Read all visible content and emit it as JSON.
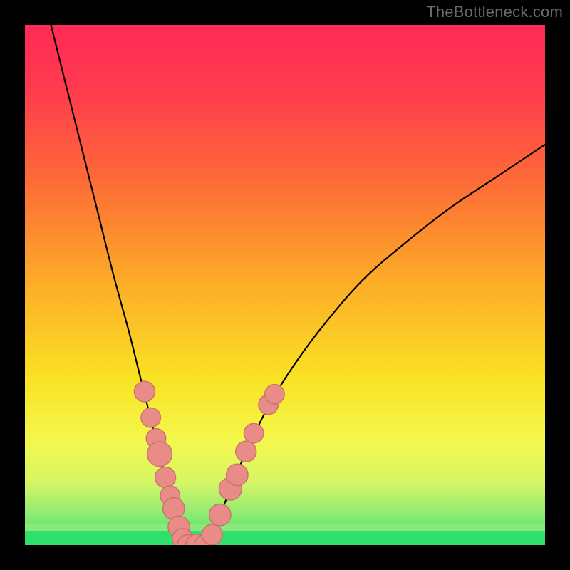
{
  "watermark": "TheBottleneck.com",
  "colors": {
    "gradient_stops": [
      {
        "offset": 0.0,
        "color": "#ff2a55"
      },
      {
        "offset": 0.12,
        "color": "#ff3a4e"
      },
      {
        "offset": 0.3,
        "color": "#fd6b37"
      },
      {
        "offset": 0.5,
        "color": "#fcae27"
      },
      {
        "offset": 0.68,
        "color": "#f9e224"
      },
      {
        "offset": 0.8,
        "color": "#f4f84d"
      },
      {
        "offset": 0.88,
        "color": "#d6f565"
      },
      {
        "offset": 0.94,
        "color": "#8feb72"
      },
      {
        "offset": 1.0,
        "color": "#2fe06a"
      }
    ],
    "curve": "#000000",
    "dot_fill": "#e98b86",
    "dot_stroke": "#c9716c",
    "frame": "#000000"
  },
  "chart_data": {
    "type": "line",
    "title": "",
    "xlabel": "",
    "ylabel": "",
    "xlim": [
      0,
      100
    ],
    "ylim": [
      0,
      100
    ],
    "grid": false,
    "legend": false,
    "series": [
      {
        "name": "left_curve",
        "x": [
          5,
          8,
          11,
          14,
          17,
          20,
          22,
          24,
          25.5,
          27,
          28,
          29,
          29.7,
          30.3,
          31
        ],
        "y": [
          100,
          88,
          76,
          64,
          52,
          41,
          33,
          25,
          19,
          13,
          9,
          5.5,
          3,
          1.2,
          0
        ]
      },
      {
        "name": "floor",
        "x": [
          31,
          32,
          33,
          34,
          35
        ],
        "y": [
          0,
          0,
          0,
          0,
          0
        ]
      },
      {
        "name": "right_curve",
        "x": [
          35,
          36.5,
          38,
          40,
          43,
          47,
          52,
          58,
          65,
          73,
          82,
          91,
          100
        ],
        "y": [
          0,
          3,
          7,
          12,
          19,
          27,
          35,
          43,
          51,
          58,
          65,
          71,
          77
        ]
      }
    ],
    "markers": [
      {
        "x": 23.0,
        "y": 29.5,
        "r": 1.3
      },
      {
        "x": 24.2,
        "y": 24.5,
        "r": 1.2
      },
      {
        "x": 25.2,
        "y": 20.5,
        "r": 1.2
      },
      {
        "x": 25.9,
        "y": 17.5,
        "r": 1.7
      },
      {
        "x": 27.0,
        "y": 13.0,
        "r": 1.3
      },
      {
        "x": 27.9,
        "y": 9.5,
        "r": 1.2
      },
      {
        "x": 28.6,
        "y": 7.0,
        "r": 1.4
      },
      {
        "x": 29.6,
        "y": 3.5,
        "r": 1.4
      },
      {
        "x": 30.3,
        "y": 1.2,
        "r": 1.3
      },
      {
        "x": 31.3,
        "y": 0.0,
        "r": 1.3
      },
      {
        "x": 33.0,
        "y": 0.0,
        "r": 1.4
      },
      {
        "x": 34.6,
        "y": 0.0,
        "r": 1.3
      },
      {
        "x": 36.0,
        "y": 2.0,
        "r": 1.3
      },
      {
        "x": 37.5,
        "y": 5.8,
        "r": 1.4
      },
      {
        "x": 39.5,
        "y": 10.8,
        "r": 1.5
      },
      {
        "x": 40.8,
        "y": 13.5,
        "r": 1.4
      },
      {
        "x": 42.5,
        "y": 18.0,
        "r": 1.3
      },
      {
        "x": 44.0,
        "y": 21.5,
        "r": 1.2
      },
      {
        "x": 46.8,
        "y": 27.0,
        "r": 1.2
      },
      {
        "x": 48.0,
        "y": 29.0,
        "r": 1.2
      }
    ],
    "green_band_y": [
      0,
      3
    ]
  }
}
